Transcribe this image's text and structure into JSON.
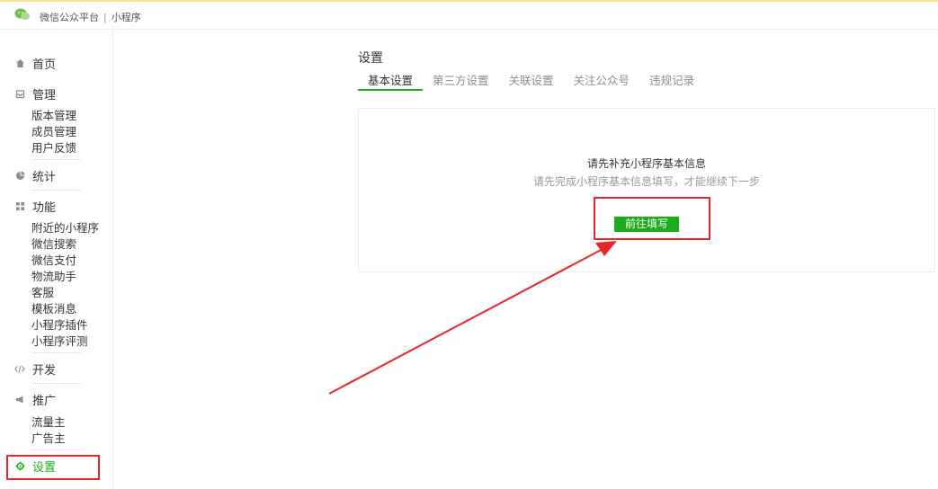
{
  "header": {
    "brand": "微信公众平台",
    "separator": "|",
    "product": "小程序"
  },
  "sidebar": {
    "home": "首页",
    "manage": {
      "label": "管理",
      "items": [
        "版本管理",
        "成员管理",
        "用户反馈"
      ]
    },
    "stats": "统计",
    "features": {
      "label": "功能",
      "items": [
        "附近的小程序",
        "微信搜索",
        "微信支付",
        "物流助手",
        "客服",
        "模板消息",
        "小程序插件",
        "小程序评测"
      ]
    },
    "develop": "开发",
    "promote": {
      "label": "推广",
      "items": [
        "流量主",
        "广告主"
      ]
    },
    "settings": "设置"
  },
  "main": {
    "title": "设置",
    "tabs": [
      "基本设置",
      "第三方设置",
      "关联设置",
      "关注公众号",
      "违规记录"
    ],
    "active_tab": 0,
    "card": {
      "title": "请先补充小程序基本信息",
      "desc": "请先完成小程序基本信息填写，才能继续下一步",
      "button": "前往填写"
    }
  },
  "colors": {
    "accent": "#1aad19",
    "annotation": "#e5272c"
  }
}
